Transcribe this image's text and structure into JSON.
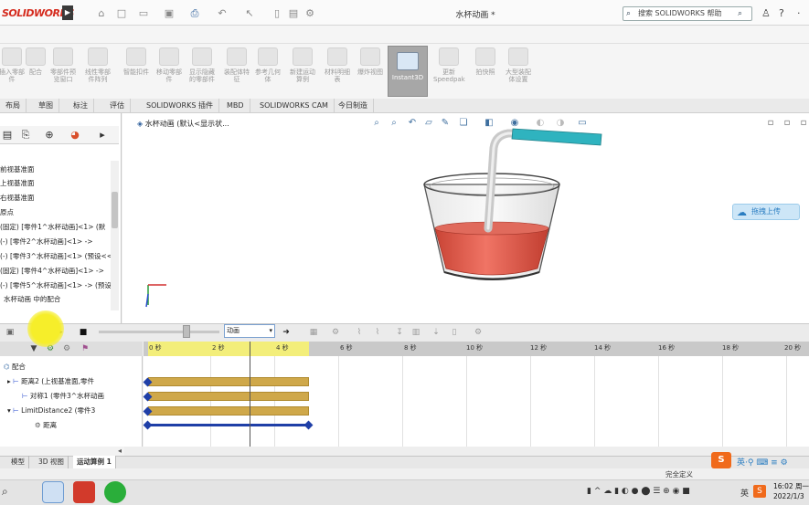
{
  "app": {
    "logo_text": "SOLIDWORKS",
    "window_title": "水杯动画 *"
  },
  "help": {
    "search_placeholder": "搜索 SOLIDWORKS 帮助"
  },
  "ribbon": {
    "buttons": [
      "插入零部件",
      "配合",
      "零部件预览窗口",
      "线性零部件阵列",
      "智能扣件",
      "移动零部件",
      "显示隐藏的零部件",
      "装配体特征",
      "参考几何体",
      "新建运动算例",
      "材料明细表",
      "爆炸视图"
    ],
    "instant3d": "Instant3D",
    "more": [
      "更新Speedpak",
      "拍快照",
      "大型装配体设置"
    ]
  },
  "tabs": [
    "布局",
    "草图",
    "标注",
    "评估",
    "SOLIDWORKS 插件",
    "MBD",
    "SOLIDWORKS CAM",
    "今日制造"
  ],
  "tree": {
    "items": [
      "前视基准面",
      "上视基准面",
      "右视基准面",
      "原点",
      "(固定) [零件1^水杯动画]<1> (默",
      "(-) [零件2^水杯动画]<1> ->",
      "(-) [零件3^水杯动画]<1> (预设<<预",
      "(固定) [零件4^水杯动画]<1> ->",
      "(-) [零件5^水杯动画]<1> -> (预设<",
      "水杯动画 中的配合"
    ]
  },
  "graphics": {
    "doc_label": "水杯动画 (默认<显示状...",
    "upload_label": "拖拽上传"
  },
  "motion": {
    "study_type": "动画"
  },
  "timeline": {
    "ticks": [
      "0 秒",
      "2 秒",
      "4 秒",
      "6 秒",
      "8 秒",
      "10 秒",
      "12 秒",
      "14 秒",
      "16 秒",
      "18 秒",
      "20 秒"
    ],
    "items": [
      "配合",
      "距离2 (上视基准面,零件",
      "对称1 (零件3^水杯动画",
      "LimitDistance2 (零件3",
      "距离"
    ]
  },
  "bottom_tabs": [
    "模型",
    "3D 视图",
    "运动算例 1"
  ],
  "status": {
    "text": "完全定义"
  },
  "taskbar": {
    "tray_lang": "英",
    "time": "16:02 周一",
    "date": "2022/1/3"
  },
  "colors": {
    "accent": "#2a7dc1",
    "logo": "#d52b1e",
    "bar": "#cfa84a",
    "key": "#1f3fa7",
    "liquid": "#e05a4c",
    "straw_tip": "#2fb3bf"
  }
}
